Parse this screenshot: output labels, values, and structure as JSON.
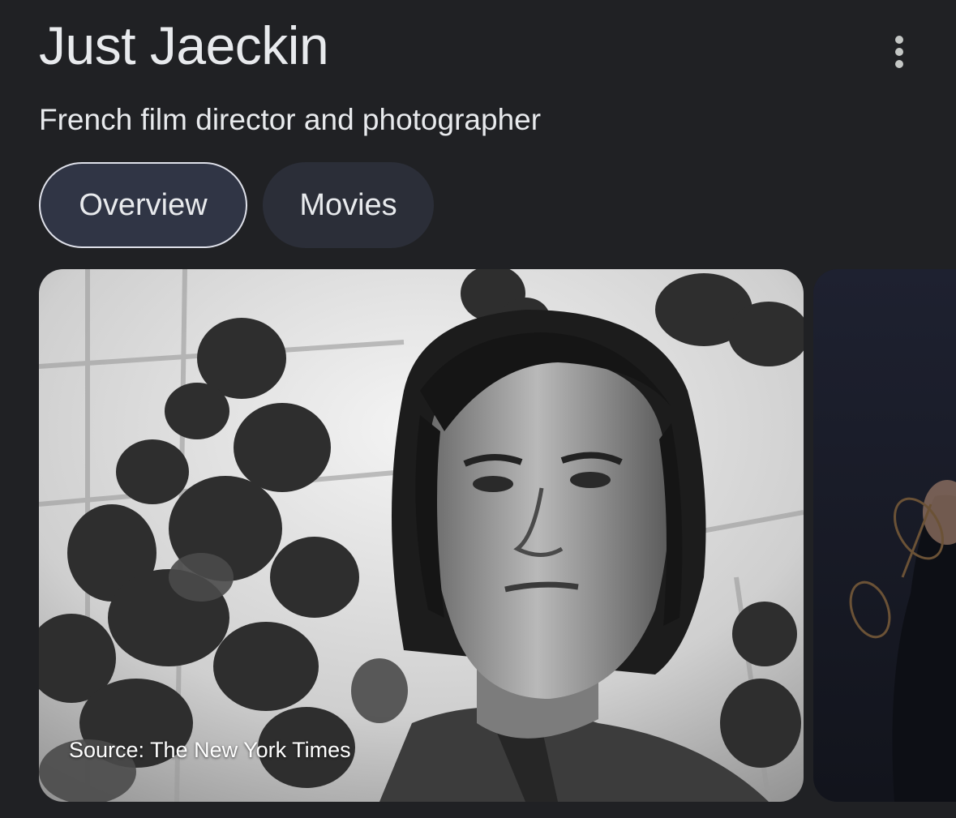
{
  "header": {
    "title": "Just Jaeckin",
    "subtitle": "French film director and photographer",
    "menu_icon": "more-vert-icon"
  },
  "tabs": [
    {
      "label": "Overview",
      "active": true
    },
    {
      "label": "Movies",
      "active": false
    }
  ],
  "images": {
    "primary": {
      "source_caption": "Source: The New York Times",
      "description_icon": "portrait-photo"
    },
    "secondary": {
      "description_icon": "portrait-photo"
    }
  },
  "colors": {
    "background": "#202124",
    "text": "#e8eaed",
    "active_tab_bg": "#303545",
    "inactive_tab_bg": "#2b2e38"
  }
}
